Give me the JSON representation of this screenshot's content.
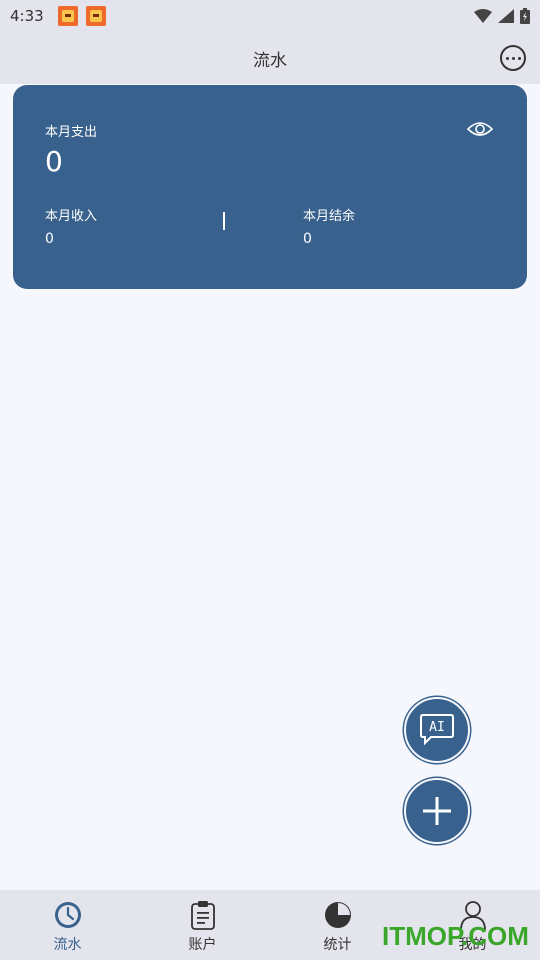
{
  "status_bar": {
    "time": "4:33",
    "notification_icons": [
      "app-notification-icon",
      "app-notification-icon"
    ],
    "right_icons": [
      "wifi-icon",
      "signal-icon",
      "battery-icon"
    ]
  },
  "header": {
    "title": "流水",
    "more_icon": "more-icon"
  },
  "summary": {
    "expense_label": "本月支出",
    "expense_value": "0",
    "income_label": "本月收入",
    "income_value": "0",
    "divider": "|",
    "balance_label": "本月结余",
    "balance_value": "0",
    "visibility_icon": "eye-icon"
  },
  "fabs": {
    "ai_label": "AI",
    "add_icon": "plus-icon"
  },
  "bottom_nav": {
    "items": [
      {
        "label": "流水",
        "icon": "clock-icon",
        "active": true
      },
      {
        "label": "账户",
        "icon": "clipboard-icon",
        "active": false
      },
      {
        "label": "统计",
        "icon": "pie-chart-icon",
        "active": false
      },
      {
        "label": "我的",
        "icon": "user-icon",
        "active": false
      }
    ]
  },
  "watermark": "ITMOP.COM",
  "colors": {
    "accent": "#38618e",
    "background": "#f6f7fd",
    "bar_background": "#e4e5ec"
  }
}
